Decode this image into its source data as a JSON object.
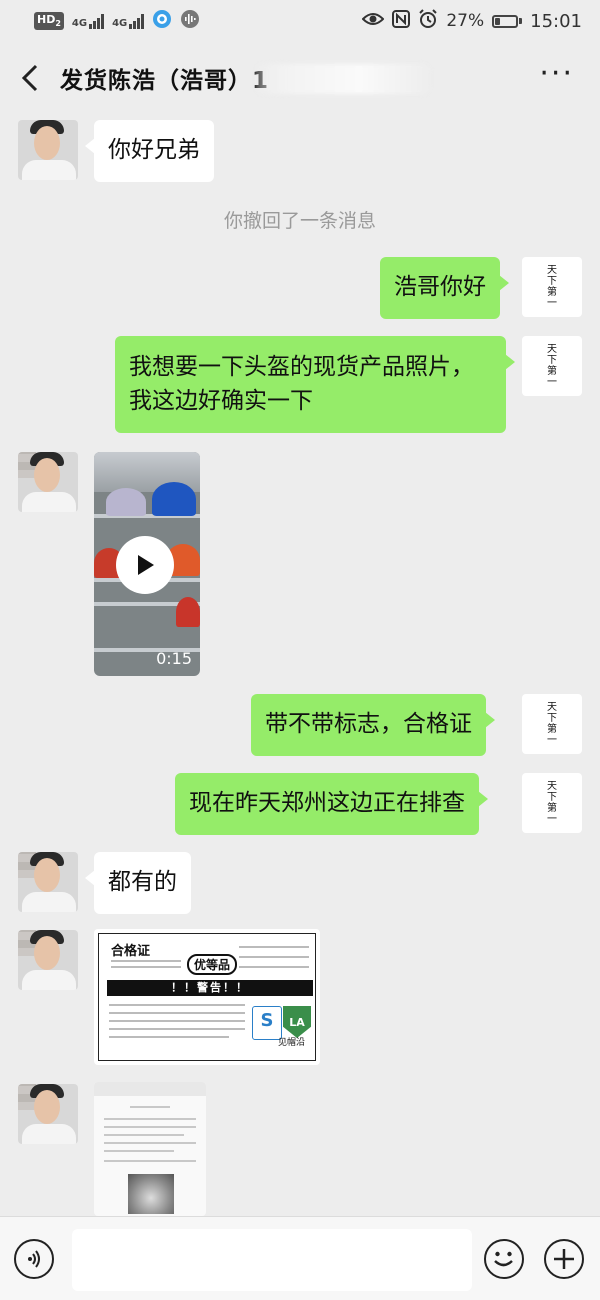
{
  "status_bar": {
    "hd_label": "HD",
    "hd_sub": "2",
    "net1": "4G",
    "net2": "4G",
    "battery_pct": "27%",
    "battery_level": 0.27,
    "time": "15:01",
    "icons": [
      "eye-icon",
      "nfc-icon",
      "alarm-icon",
      "battery-icon",
      "signal-icon",
      "wechat-status-icon",
      "voice-wave-icon"
    ]
  },
  "header": {
    "back_icon": "chevron-left-icon",
    "title": "发货陈浩（浩哥）1",
    "more_icon": "more-dots-icon",
    "more_label": "···"
  },
  "messages": [
    {
      "from": "other",
      "type": "text",
      "text": "你好兄弟"
    },
    {
      "type": "system",
      "text": "你撤回了一条消息"
    },
    {
      "from": "me",
      "type": "text",
      "text": "浩哥你好"
    },
    {
      "from": "me",
      "type": "text",
      "lines": [
        "我想要一下头盔的现货产品照片，",
        "我这边好确实一下"
      ]
    },
    {
      "from": "other",
      "type": "video",
      "duration": "0:15"
    },
    {
      "from": "me",
      "type": "text",
      "text": "带不带标志，合格证"
    },
    {
      "from": "me",
      "type": "text",
      "text": "现在昨天郑州这边正在排查"
    },
    {
      "from": "other",
      "type": "text",
      "text": "都有的"
    },
    {
      "from": "other",
      "type": "image",
      "title": "合格证",
      "badge": "优等品",
      "warning": "！！警告！！",
      "signature": "见帽沿",
      "logo_left": "S",
      "logo_right": "LA"
    },
    {
      "from": "other",
      "type": "image",
      "caption": "文档照片"
    }
  ],
  "my_avatar_text": "天下第一",
  "input_bar": {
    "voice_icon": "voice-icon",
    "emoji_icon": "emoji-icon",
    "plus_icon": "plus-icon",
    "placeholder": ""
  },
  "colors": {
    "background": "#ededed",
    "my_bubble": "#95ec69",
    "other_bubble": "#ffffff",
    "system_text": "#9a9a9a"
  }
}
